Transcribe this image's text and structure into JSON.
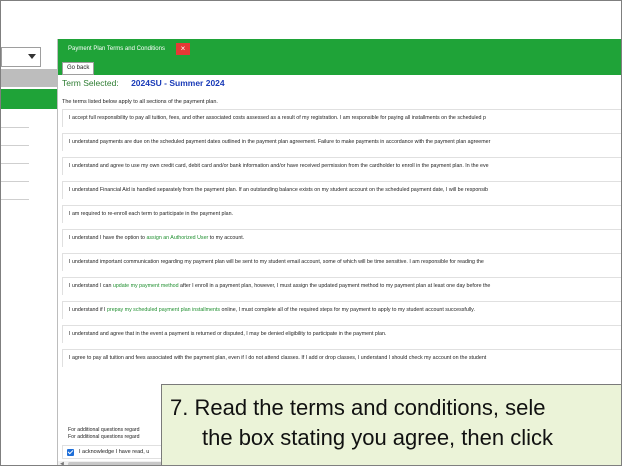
{
  "modal": {
    "tab_title": "Payment Plan Terms and Conditions",
    "tab_close": "×",
    "go_back": "Go back",
    "term_label": "Term Selected:",
    "term_value": "2024SU - Summer 2024",
    "intro": "The terms listed below apply to all sections of the payment plan."
  },
  "terms": [
    {
      "text": "I accept full responsibility to pay all tuition, fees, and other associated costs assessed as a result of my registration. I am responsible for paying all installments on the scheduled p"
    },
    {
      "text": "I understand payments are due on the scheduled payment dates outlined in the payment plan agreement. Failure to make payments in accordance with the payment plan agreemer"
    },
    {
      "text": "I understand and agree to use my own credit card, debit card and/or bank information and/or have received permission from the cardholder to enroll in the payment plan. In the eve"
    },
    {
      "text": "I understand Financial Aid is handled separately from the payment plan. If an outstanding balance exists on my student account on the scheduled payment date, I will be responsib"
    },
    {
      "text": "I am required to re-enroll each term to participate in the payment plan."
    },
    {
      "pre": "I understand I have the option to ",
      "link": "assign an Authorized User",
      "post": " to my account."
    },
    {
      "text": "I understand important communication regarding my payment plan will be sent to my student email account, some of which will be time sensitive. I am responsible for reading the"
    },
    {
      "pre": "I understand I can ",
      "link": "update my payment method",
      "post": " after I enroll in a payment plan, however, I must assign the updated payment method to my payment plan at least one day before the"
    },
    {
      "pre": "I understand if I ",
      "link": "prepay my scheduled payment plan installments",
      "post": " online, I must complete all of the required steps for my payment to apply to my student account successfully."
    },
    {
      "text": "I understand and agree that in the event a payment is returned or disputed, I may be denied eligibility to participate in the payment plan."
    },
    {
      "text": "I agree to pay all tuition and fees associated with the payment plan, even if I do not attend classes. If I add or drop classes, I understand I should check my account on the student"
    }
  ],
  "extra_lines": [
    "For additional questions regard",
    "For additional questions regard"
  ],
  "acknowledge": "I acknowledge I have read, u",
  "callout": {
    "line1": "7. Read the terms and conditions, sele",
    "line2": "the box stating you agree, then click"
  },
  "colors": {
    "accent_green": "#1fa338",
    "term_blue": "#1a3bb8",
    "callout_bg": "#ebf3d8"
  }
}
